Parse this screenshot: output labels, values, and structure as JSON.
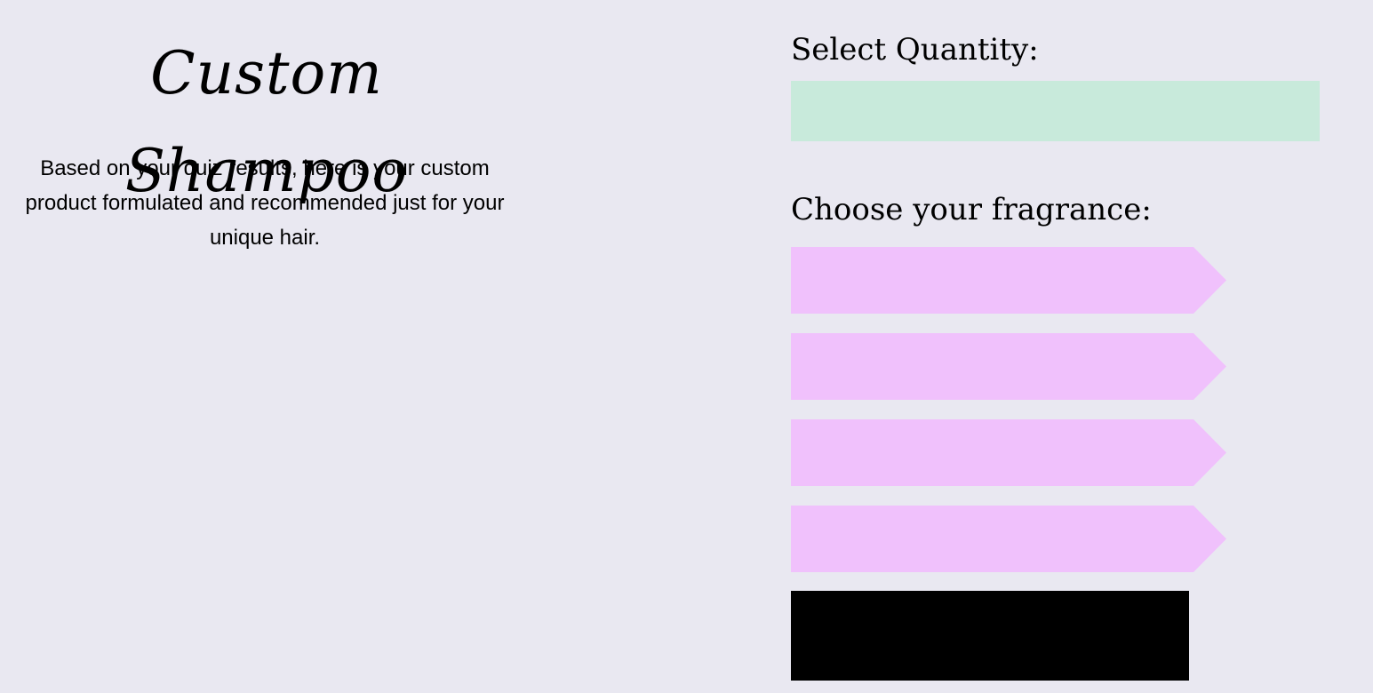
{
  "colors": {
    "background": "#e9e8f1",
    "quantity_field": "#c8eadb",
    "fragrance_option": "#f0c1fc",
    "submit_button": "#000000"
  },
  "product": {
    "title": "Custom Shampoo",
    "description": "Based on your quiz results, here is your custom product formulated and recommended just for your unique hair."
  },
  "quantity": {
    "label": "Select Quantity:",
    "value": "",
    "placeholder": ""
  },
  "fragrance": {
    "label": "Choose your fragrance:",
    "options": [
      {
        "label": ""
      },
      {
        "label": ""
      },
      {
        "label": ""
      },
      {
        "label": ""
      }
    ]
  },
  "submit": {
    "label": ""
  }
}
